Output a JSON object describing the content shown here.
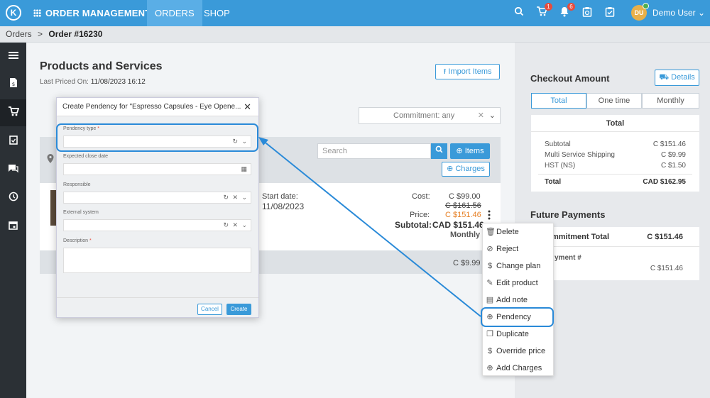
{
  "topbar": {
    "logo": "K",
    "app_title": "ORDER MANAGEMENT",
    "tabs": [
      "ORDERS",
      "SHOP"
    ],
    "cart_badge": "1",
    "bell_badge": "6",
    "avatar_initials": "DU",
    "user_name": "Demo User"
  },
  "breadcrumb": {
    "root": "Orders",
    "separator": ">",
    "current": "Order #16230"
  },
  "products": {
    "title": "Products and Services",
    "last_priced_label": "Last Priced On:",
    "last_priced_value": "11/08/2023 16:12",
    "import_button": "Import Items",
    "commitment_select": "Commitment: any",
    "search_placeholder": "Search",
    "items_button": "Items",
    "charges_button": "Charges",
    "line": {
      "start_label": "Start date:",
      "start_value": "11/08/2023",
      "cost_label": "Cost:",
      "cost_value": "C $99.00",
      "old_price": "C $161.56",
      "price_label": "Price:",
      "price_value": "C $151.46",
      "subtotal_label": "Subtotal:",
      "subtotal_value": "CAD $151.46",
      "period": "Monthly"
    },
    "charge_total": "C $9.99"
  },
  "context_menu": [
    {
      "icon": "trash-icon",
      "glyph": "🗑",
      "label": "Delete"
    },
    {
      "icon": "ban-icon",
      "glyph": "⊘",
      "label": "Reject"
    },
    {
      "icon": "dollar-icon",
      "glyph": "$",
      "label": "Change plan"
    },
    {
      "icon": "pencil-icon",
      "glyph": "✎",
      "label": "Edit product"
    },
    {
      "icon": "note-icon",
      "glyph": "▤",
      "label": "Add note"
    },
    {
      "icon": "plus-circle-icon",
      "glyph": "⊕",
      "label": "Pendency"
    },
    {
      "icon": "copy-icon",
      "glyph": "❐",
      "label": "Duplicate"
    },
    {
      "icon": "dollar-icon",
      "glyph": "$",
      "label": "Override price"
    },
    {
      "icon": "plus-circle-icon",
      "glyph": "⊕",
      "label": "Add Charges"
    }
  ],
  "modal": {
    "title": "Create Pendency for \"Espresso Capsules - Eye Opene...",
    "close": "✕",
    "fields": [
      {
        "label": "Pendency type",
        "required": "*"
      },
      {
        "label": "Expected close date",
        "required": ""
      },
      {
        "label": "Responsible",
        "required": ""
      },
      {
        "label": "External system",
        "required": ""
      },
      {
        "label": "Description",
        "required": "*"
      }
    ],
    "cancel": "Cancel",
    "create": "Create"
  },
  "checkout": {
    "title": "Checkout Amount",
    "details_button": "Details",
    "tabs": [
      "Total",
      "One time",
      "Monthly"
    ],
    "card_title": "Total",
    "rows": [
      {
        "label": "Subtotal",
        "value": "C $151.46"
      },
      {
        "label": "Multi Service Shipping",
        "value": "C $9.99"
      },
      {
        "label": "HST (NS)",
        "value": "C $1.50"
      }
    ],
    "total_label": "Total",
    "total_value": "CAD $162.95"
  },
  "future": {
    "title": "Future Payments",
    "commitment_label": "mmitment Total",
    "commitment_value": "C $151.46",
    "payment_label": "yment #",
    "payment_value": "C $151.46"
  },
  "colors": {
    "primary": "#3a9ad9",
    "sidebar": "#2b3035",
    "highlight": "#2a8ad8"
  }
}
